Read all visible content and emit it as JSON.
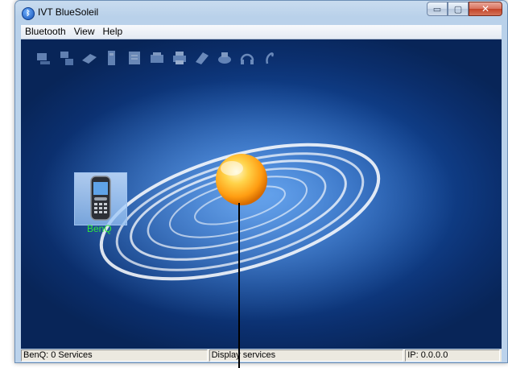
{
  "window": {
    "title": "IVT BlueSoleil",
    "minimize_glyph": "▭",
    "maximize_glyph": "▢",
    "close_glyph": "✕"
  },
  "menu": {
    "items": [
      {
        "label": "Bluetooth"
      },
      {
        "label": "View"
      },
      {
        "label": "Help"
      }
    ]
  },
  "toolbar": {
    "icons": [
      "personal-area-network-icon",
      "network-access-icon",
      "fax-icon",
      "file-transfer-icon",
      "object-push-icon",
      "serial-port-icon",
      "printer-icon",
      "dial-up-networking-icon",
      "modem-icon",
      "headset-icon",
      "audio-gateway-icon"
    ]
  },
  "devices": [
    {
      "label": "BenQ",
      "type": "mobile-phone-icon"
    }
  ],
  "statusbar": {
    "left": "BenQ: 0 Services",
    "middle": "Display services",
    "right": "IP: 0.0.0.0"
  },
  "colors": {
    "background": "#11428f",
    "device_label": "#2ee63c",
    "local_device_orb": "#ffb320"
  }
}
